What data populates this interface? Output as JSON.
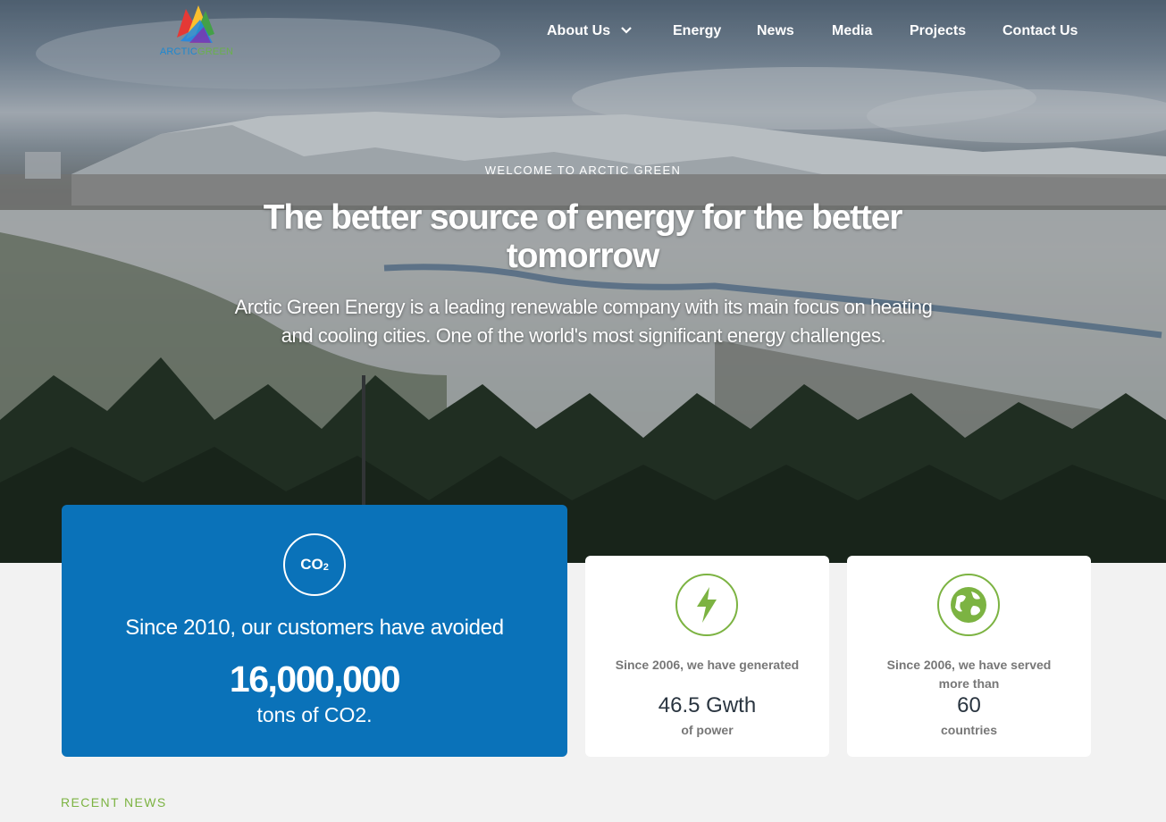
{
  "logo": {
    "text_part1": "ARCTIC",
    "text_part2": "GREEN"
  },
  "nav": {
    "items": [
      {
        "label": "About Us",
        "has_dropdown": true
      },
      {
        "label": "Energy"
      },
      {
        "label": "News"
      },
      {
        "label": "Media"
      },
      {
        "label": "Projects"
      },
      {
        "label": "Contact Us"
      }
    ]
  },
  "hero": {
    "eyebrow": "WELCOME TO ARCTIC GREEN",
    "headline": "The better source of energy for the better tomorrow",
    "lead": "Arctic Green Energy is a leading renewable company with its main focus on heating and cooling cities. One of the world's most significant energy challenges."
  },
  "stats": {
    "main": {
      "icon": "co2-icon",
      "icon_text": "CO",
      "icon_sub": "2",
      "label": "Since 2010, our customers have avoided",
      "value": "16,000,000",
      "unit": "tons of CO2."
    },
    "cards": [
      {
        "icon": "lightning-icon",
        "pre": "Since 2006, we have generated",
        "value": "46.5 Gwth",
        "post": "of power"
      },
      {
        "icon": "globe-icon",
        "pre": "Since 2006, we have served more than",
        "value": "60",
        "post": "countries"
      }
    ]
  },
  "recent_news": {
    "label": "RECENT NEWS"
  },
  "colors": {
    "brand_blue": "#0a72b9",
    "brand_green": "#7cb342",
    "page_bg": "#f2f2f2"
  }
}
